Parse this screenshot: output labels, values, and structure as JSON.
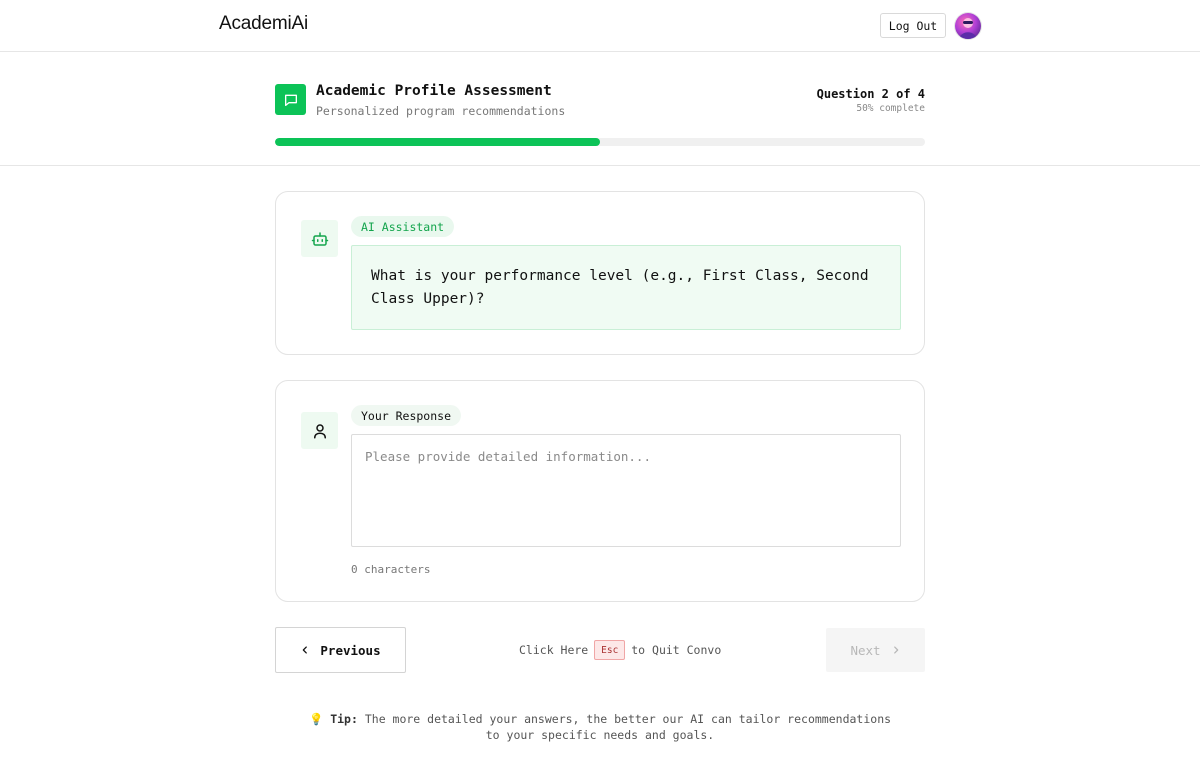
{
  "nav": {
    "brand": "AcademiAi",
    "logout_label": "Log Out"
  },
  "header": {
    "title": "Academic Profile Assessment",
    "subtitle": "Personalized program recommendations",
    "question_count": "Question 2 of 4",
    "percent_complete": "50% complete",
    "progress": 0.5,
    "icon": "chat-bubble-icon"
  },
  "ai_card": {
    "tag": "AI Assistant",
    "icon": "robot-icon",
    "question": "What is your performance level (e.g., First Class, Second Class Upper)?"
  },
  "user_card": {
    "tag": "Your Response",
    "icon": "user-icon",
    "placeholder": "Please provide detailed information...",
    "value": "",
    "char_count": "0 characters"
  },
  "controls": {
    "previous_label": "Previous",
    "quit_prefix": "Click Here",
    "esc_label": "Esc",
    "quit_suffix": "to Quit Convo",
    "next_label": "Next"
  },
  "tip": {
    "emoji": "💡",
    "label": "Tip:",
    "text": "The more detailed your answers, the better our AI can tailor recommendations to your specific needs and goals."
  },
  "colors": {
    "accent": "#0cc357",
    "accent_light": "#f0fbf3",
    "esc_bg": "#fde8e8"
  }
}
